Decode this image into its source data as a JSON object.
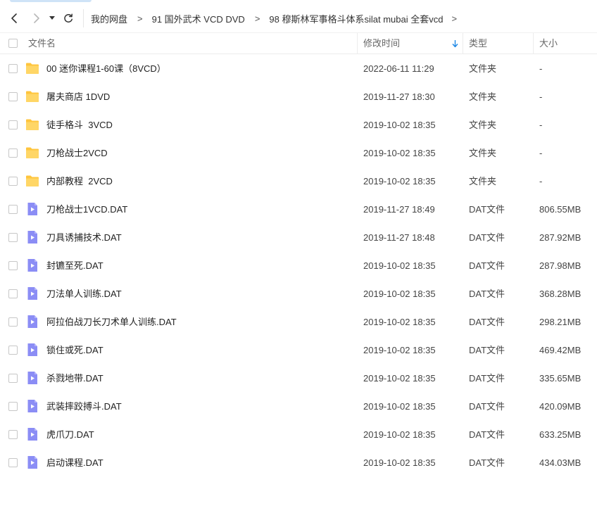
{
  "navigation": {
    "back_icon": "chevron-left-icon",
    "forward_icon": "chevron-right-icon",
    "history_icon": "caret-down-icon",
    "refresh_icon": "refresh-icon"
  },
  "breadcrumb": [
    "我的网盘",
    "91 国外武术 VCD DVD",
    "98 穆斯林军事格斗体系silat mubai 全套vcd"
  ],
  "breadcrumb_separator": ">",
  "columns": {
    "name": "文件名",
    "modified": "修改时间",
    "type": "类型",
    "size": "大小"
  },
  "sort": {
    "column": "modified",
    "direction": "descending",
    "icon": "arrow-down-icon"
  },
  "colors": {
    "folder": "#FFC53D",
    "video_file": "#8B8DF5",
    "sort_arrow": "#1E88E5"
  },
  "files": [
    {
      "kind": "folder",
      "name": "00 迷你课程1-60课（8VCD）",
      "modified": "2022-06-11 11:29",
      "type": "文件夹",
      "size": "-"
    },
    {
      "kind": "folder",
      "name": "屠夫商店 1DVD",
      "modified": "2019-11-27 18:30",
      "type": "文件夹",
      "size": "-"
    },
    {
      "kind": "folder",
      "name": "徒手格斗  3VCD",
      "modified": "2019-10-02 18:35",
      "type": "文件夹",
      "size": "-"
    },
    {
      "kind": "folder",
      "name": "刀枪战士2VCD",
      "modified": "2019-10-02 18:35",
      "type": "文件夹",
      "size": "-"
    },
    {
      "kind": "folder",
      "name": "内部教程  2VCD",
      "modified": "2019-10-02 18:35",
      "type": "文件夹",
      "size": "-"
    },
    {
      "kind": "video",
      "name": "刀枪战士1VCD.DAT",
      "modified": "2019-11-27 18:49",
      "type": "DAT文件",
      "size": "806.55MB"
    },
    {
      "kind": "video",
      "name": "刀具诱捕技术.DAT",
      "modified": "2019-11-27 18:48",
      "type": "DAT文件",
      "size": "287.92MB"
    },
    {
      "kind": "video",
      "name": "封镳至死.DAT",
      "modified": "2019-10-02 18:35",
      "type": "DAT文件",
      "size": "287.98MB"
    },
    {
      "kind": "video",
      "name": "刀法单人训练.DAT",
      "modified": "2019-10-02 18:35",
      "type": "DAT文件",
      "size": "368.28MB"
    },
    {
      "kind": "video",
      "name": "阿拉伯战刀长刀术单人训练.DAT",
      "modified": "2019-10-02 18:35",
      "type": "DAT文件",
      "size": "298.21MB"
    },
    {
      "kind": "video",
      "name": "锁住或死.DAT",
      "modified": "2019-10-02 18:35",
      "type": "DAT文件",
      "size": "469.42MB"
    },
    {
      "kind": "video",
      "name": "杀戮地带.DAT",
      "modified": "2019-10-02 18:35",
      "type": "DAT文件",
      "size": "335.65MB"
    },
    {
      "kind": "video",
      "name": "武装摔跤搏斗.DAT",
      "modified": "2019-10-02 18:35",
      "type": "DAT文件",
      "size": "420.09MB"
    },
    {
      "kind": "video",
      "name": "虎爪刀.DAT",
      "modified": "2019-10-02 18:35",
      "type": "DAT文件",
      "size": "633.25MB"
    },
    {
      "kind": "video",
      "name": "启动课程.DAT",
      "modified": "2019-10-02 18:35",
      "type": "DAT文件",
      "size": "434.03MB"
    }
  ]
}
